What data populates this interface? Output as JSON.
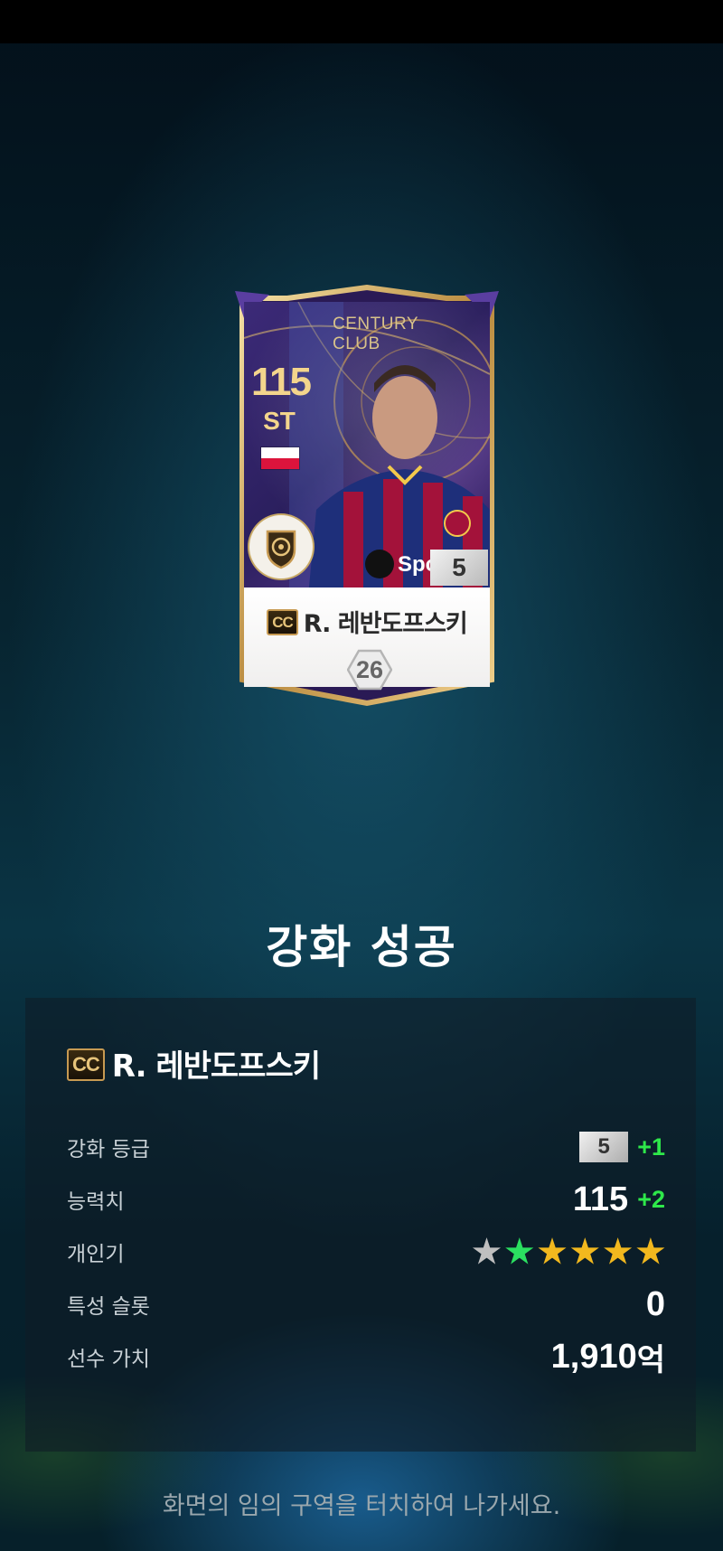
{
  "card": {
    "rating": "115",
    "position": "ST",
    "club_line1": "CENTURY",
    "club_line2": "CLUB",
    "grade": "5",
    "badge": "CC",
    "name": "R. 레반도프스키",
    "overall": "26",
    "sponsor_text": "Spo"
  },
  "result": {
    "title": "강화 성공",
    "badge": "CC",
    "player_name": "R. 레반도프스키",
    "rows": [
      {
        "label": "강화 등급",
        "grade": "5",
        "delta": "+1"
      },
      {
        "label": "능력치",
        "value": "115",
        "delta": "+2"
      },
      {
        "label": "개인기",
        "stars_total": 6,
        "stars_gray": 1,
        "stars_green": 1,
        "stars_gold": 4
      },
      {
        "label": "특성 슬롯",
        "value": "0"
      },
      {
        "label": "선수 가치",
        "value": "1,910",
        "unit": "억"
      }
    ]
  },
  "footer": {
    "text": "화면의 임의 구역을 터치하여 나가세요."
  },
  "colors": {
    "delta_green": "#2ee84a",
    "card_gold": "#f3d58c",
    "card_purple": "#3c2a78"
  },
  "icons": [
    "flag-poland-icon",
    "club-emblem-icon",
    "star-icon",
    "hexagon-icon"
  ]
}
